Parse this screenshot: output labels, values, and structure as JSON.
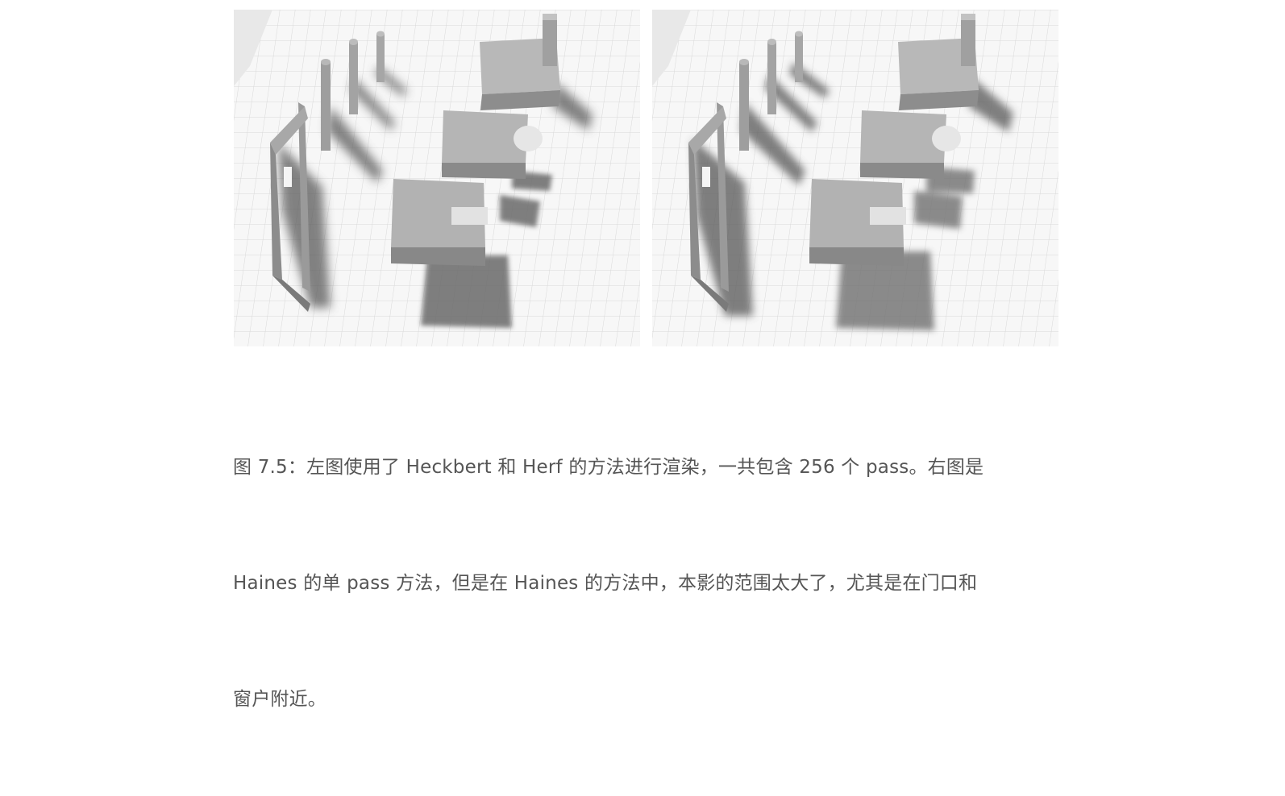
{
  "figure": {
    "caption_lines": [
      "图 7.5：左图使用了 Heckbert 和 Herf 的方法进行渲染，一共包含 256 个 pass。右图是",
      "Haines 的单 pass 方法，但是在 Haines 的方法中，本影的范围太大了，尤其是在门口和",
      "窗户附近。"
    ]
  }
}
